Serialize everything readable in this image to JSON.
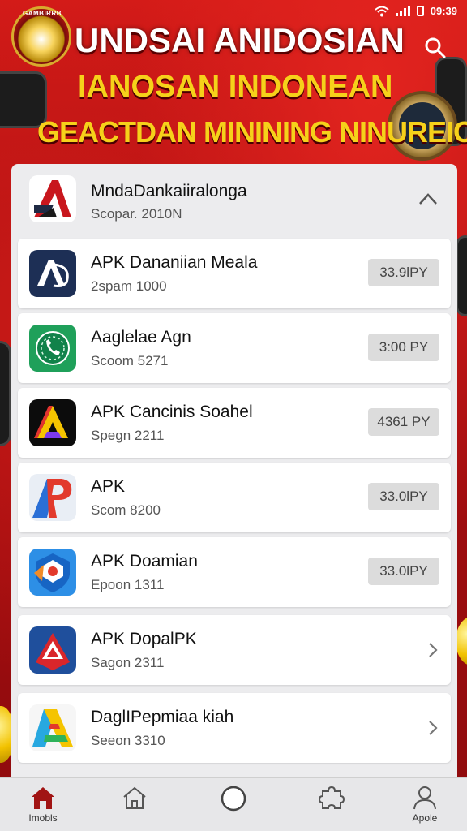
{
  "status_bar": {
    "time": "09:39"
  },
  "banner": {
    "emblem_text_top": "GAMBIRRB",
    "title": "UNDSAI ANIDOSIAN",
    "subtitle_1": "IANOSAN INDONEAN",
    "subtitle_2": "GEACTDAN MININING NINUREIC"
  },
  "header_app": {
    "name": "MndaDankaiiralonga",
    "sub": "Scopar. 2010N"
  },
  "apps": [
    {
      "name": "APK Dananiian Meala",
      "sub": "2spam 1000",
      "price": "33.9lPY",
      "icon": "ad-logo-icon"
    },
    {
      "name": "Aaglelae Agn",
      "sub": "Scoom 5271",
      "price": "3:00 PY",
      "icon": "phone-logo-icon"
    },
    {
      "name": "APK Cancinis Soahel",
      "sub": "Spegn 2211",
      "price": "4361 PY",
      "icon": "triangle-logo-icon"
    },
    {
      "name": "APK",
      "sub": "Scom 8200",
      "price": "33.0lPY",
      "icon": "ap-logo-icon"
    },
    {
      "name": "APK Doamian",
      "sub": "Epoon 1311",
      "price": "33.0lPY",
      "icon": "shield-logo-icon"
    },
    {
      "name": "APK DopalPK",
      "sub": "Sagon 2311",
      "icon": "red-triangle-logo-icon"
    },
    {
      "name": "DaglIPepmiaa kiah",
      "sub": "Seeon 3310",
      "icon": "colorful-a-logo-icon"
    }
  ],
  "bottom_nav": {
    "items": [
      {
        "label": "Imobls",
        "icon": "home-filled-icon",
        "active": true
      },
      {
        "label": "",
        "icon": "home-outline-icon"
      },
      {
        "label": "",
        "icon": "circle-icon"
      },
      {
        "label": "",
        "icon": "puzzle-icon"
      },
      {
        "label": "Apole",
        "icon": "person-icon"
      }
    ]
  },
  "colors": {
    "brand_red": "#b30f12",
    "banner_yellow": "#f6d11a",
    "card_bg": "#ececee",
    "price_bg": "#dcdcdc",
    "nav_active": "#a11414"
  }
}
